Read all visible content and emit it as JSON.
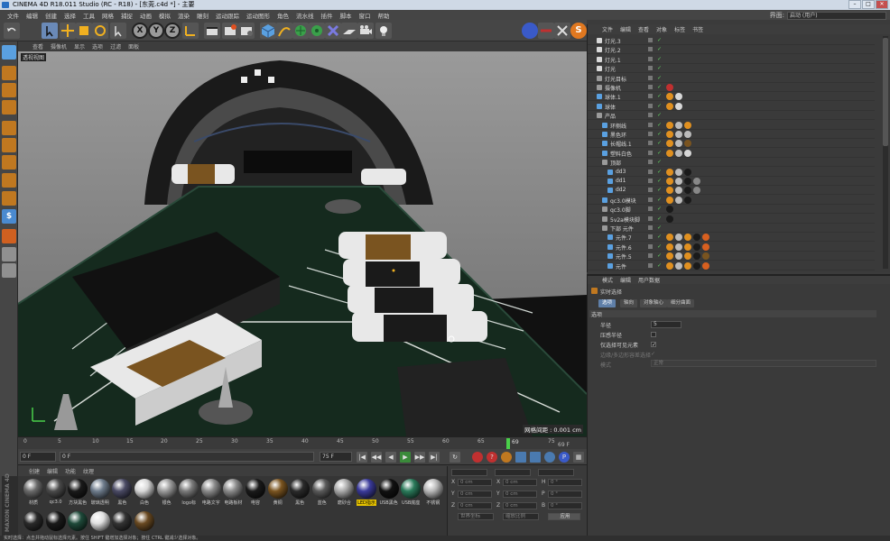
{
  "window": {
    "title": "CINEMA 4D R18.011 Studio (RC - R18) - [东莞.c4d *] - 主要"
  },
  "menubar": {
    "items": [
      "文件",
      "编辑",
      "创建",
      "选择",
      "工具",
      "网格",
      "捕捉",
      "动画",
      "模拟",
      "渲染",
      "雕刻",
      "运动跟踪",
      "运动图形",
      "角色",
      "流水线",
      "插件",
      "脚本",
      "窗口",
      "帮助"
    ],
    "interface_label": "界面:",
    "interface_value": "启动 (用户)"
  },
  "toolbar": {
    "axis_x": "X",
    "axis_y": "Y",
    "axis_z": "Z"
  },
  "viewport": {
    "menu": [
      "查看",
      "摄像机",
      "显示",
      "选项",
      "过滤",
      "面板"
    ],
    "label": "透视视图",
    "grid_spacing": "网格间距 : 0.001 cm"
  },
  "timeline": {
    "ticks": [
      "0",
      "5",
      "10",
      "15",
      "20",
      "25",
      "30",
      "35",
      "40",
      "45",
      "50",
      "55",
      "60",
      "65",
      "70",
      "75"
    ],
    "current_frame": "69",
    "end_frame_label": "69 F"
  },
  "transport": {
    "start": "0 F",
    "current": "0 F",
    "end": "75 F",
    "max": "75 F"
  },
  "materials": {
    "menu": [
      "创建",
      "编辑",
      "功能",
      "纹理"
    ],
    "items": [
      {
        "label": "材质",
        "color": "#6a6a6a"
      },
      {
        "label": "qc3.0",
        "color": "#4a4a4a"
      },
      {
        "label": "方块黑色",
        "color": "#1a1a1a"
      },
      {
        "label": "玻璃透明",
        "color": "#6e7c8c"
      },
      {
        "label": "黑色",
        "color": "#4a4a64"
      },
      {
        "label": "白色",
        "color": "#d8d8d8"
      },
      {
        "label": "银色",
        "color": "#9a9a9a"
      },
      {
        "label": "logo标",
        "color": "#7a7a7a"
      },
      {
        "label": "电路文字",
        "color": "#8a8a8a"
      },
      {
        "label": "电路板材",
        "color": "#8a8a8a"
      },
      {
        "label": "电容",
        "color": "#1a1a1a"
      },
      {
        "label": "黄铜",
        "color": "#7a5420"
      },
      {
        "label": "黑色",
        "color": "#2a2a2a"
      },
      {
        "label": "蓝色",
        "color": "#5a5a5a"
      },
      {
        "label": "磨砂合",
        "color": "#aaaaaa"
      },
      {
        "label": "LED指示",
        "color": "#3a3a9a",
        "selected": true
      },
      {
        "label": "USB黑色",
        "color": "#111111"
      },
      {
        "label": "USB底座",
        "color": "#2a7a5a"
      },
      {
        "label": "不锈钢",
        "color": "#b8b8b8"
      },
      {
        "label": "",
        "color": "#2a2a2a"
      },
      {
        "label": "",
        "color": "#1a1a1a"
      },
      {
        "label": "",
        "color": "#1f4a3a"
      },
      {
        "label": "",
        "color": "#e0e0e0"
      },
      {
        "label": "",
        "color": "#333333"
      },
      {
        "label": "",
        "color": "#6a4a22"
      }
    ]
  },
  "coordinates": {
    "rows": [
      {
        "a": "X",
        "av": "0 cm",
        "b": "X",
        "bv": "0 cm",
        "c": "H",
        "cv": "0 °"
      },
      {
        "a": "Y",
        "av": "0 cm",
        "b": "Y",
        "bv": "0 cm",
        "c": "P",
        "cv": "0 °"
      },
      {
        "a": "Z",
        "av": "0 cm",
        "b": "Z",
        "bv": "0 cm",
        "c": "B",
        "cv": "0 °"
      }
    ],
    "mode1": "世界坐标",
    "mode2": "缩放比例",
    "apply": "应用"
  },
  "statusbar": {
    "text": "实时选择：点击并拖动鼠标选择元素。按住 SHIFT 键增加选择对象；按住 CTRL 键减少选择对象。"
  },
  "objects": {
    "menu": [
      "文件",
      "编辑",
      "查看",
      "对象",
      "标签",
      "书签"
    ],
    "rows": [
      {
        "name": "灯光.3",
        "indent": 0,
        "icon": "#d8d8d8",
        "tags": []
      },
      {
        "name": "灯光.2",
        "indent": 0,
        "icon": "#d8d8d8",
        "tags": []
      },
      {
        "name": "灯光.1",
        "indent": 0,
        "icon": "#d8d8d8",
        "tags": []
      },
      {
        "name": "灯光",
        "indent": 0,
        "icon": "#d8d8d8",
        "tags": []
      },
      {
        "name": "灯光目标",
        "indent": 0,
        "icon": "#9a9a9a",
        "tags": []
      },
      {
        "name": "摄像机",
        "indent": 0,
        "icon": "#9a9a9a",
        "tags": [
          "#c03030"
        ]
      },
      {
        "name": "球体.1",
        "indent": 0,
        "icon": "#5aa0e0",
        "tags": [
          "#e09020",
          "#d8d8d8"
        ]
      },
      {
        "name": "球体",
        "indent": 0,
        "icon": "#5aa0e0",
        "tags": [
          "#e09020",
          "#d8d8d8"
        ]
      },
      {
        "name": "产品",
        "indent": 0,
        "icon": "#9a9a9a",
        "tags": []
      },
      {
        "name": "环侧线",
        "indent": 1,
        "icon": "#5aa0e0",
        "tags": [
          "#e09020",
          "#bbbbbb",
          "#e09020"
        ]
      },
      {
        "name": "黑色环",
        "indent": 1,
        "icon": "#5aa0e0",
        "tags": [
          "#e09020",
          "#bbbbbb",
          "#bbbbbb"
        ]
      },
      {
        "name": "长帽线.1",
        "indent": 1,
        "icon": "#5aa0e0",
        "tags": [
          "#e09020",
          "#bbbbbb",
          "#7a5420"
        ]
      },
      {
        "name": "塑料白色",
        "indent": 1,
        "icon": "#5aa0e0",
        "tags": [
          "#e09020",
          "#bbbbbb",
          "#d8d8d8"
        ]
      },
      {
        "name": "顶部",
        "indent": 1,
        "icon": "#9a9a9a",
        "tags": []
      },
      {
        "name": "dd3",
        "indent": 2,
        "icon": "#5aa0e0",
        "tags": [
          "#e09020",
          "#bbbbbb",
          "#1a1a1a"
        ]
      },
      {
        "name": "dd1",
        "indent": 2,
        "icon": "#5aa0e0",
        "tags": [
          "#e09020",
          "#bbbbbb",
          "#1a1a1a",
          "#888888"
        ]
      },
      {
        "name": "dd2",
        "indent": 2,
        "icon": "#5aa0e0",
        "tags": [
          "#e09020",
          "#bbbbbb",
          "#1a1a1a",
          "#888888"
        ]
      },
      {
        "name": "qc3.0模块",
        "indent": 1,
        "icon": "#5aa0e0",
        "tags": [
          "#e09020",
          "#bbbbbb",
          "#1a1a1a"
        ]
      },
      {
        "name": "qc3.0脚",
        "indent": 1,
        "icon": "#9a9a9a",
        "tags": [
          "#1a1a1a"
        ]
      },
      {
        "name": "5v2a模块脚",
        "indent": 1,
        "icon": "#9a9a9a",
        "tags": [
          "#1a1a1a"
        ]
      },
      {
        "name": "下部 元件",
        "indent": 1,
        "icon": "#9a9a9a",
        "tags": []
      },
      {
        "name": "元件.7",
        "indent": 2,
        "icon": "#5aa0e0",
        "tags": [
          "#e09020",
          "#bbbbbb",
          "#e09020",
          "#1a1a1a",
          "#d86020"
        ]
      },
      {
        "name": "元件.6",
        "indent": 2,
        "icon": "#5aa0e0",
        "tags": [
          "#e09020",
          "#bbbbbb",
          "#e09020",
          "#1a1a1a",
          "#d86020"
        ]
      },
      {
        "name": "元件.5",
        "indent": 2,
        "icon": "#5aa0e0",
        "tags": [
          "#e09020",
          "#bbbbbb",
          "#e09020",
          "#1a1a1a",
          "#7a5420"
        ]
      },
      {
        "name": "元件",
        "indent": 2,
        "icon": "#5aa0e0",
        "tags": [
          "#e09020",
          "#bbbbbb",
          "#e09020",
          "#1a1a1a",
          "#d86020"
        ]
      }
    ]
  },
  "attributes": {
    "menu": [
      "模式",
      "编辑",
      "用户数据"
    ],
    "title": "实时选择",
    "tabs": [
      "选项",
      "轴向",
      "对象轴心",
      "细分曲面"
    ],
    "section": "选项",
    "fields": [
      {
        "label": "半径",
        "value": "5"
      },
      {
        "label": "压感半径",
        "value": ""
      },
      {
        "label": "仅选择可见元素",
        "value": "✓"
      },
      {
        "label": "边缘/多边形容差选择",
        "value": "✓"
      },
      {
        "label": "模式",
        "value": "正常"
      }
    ]
  }
}
